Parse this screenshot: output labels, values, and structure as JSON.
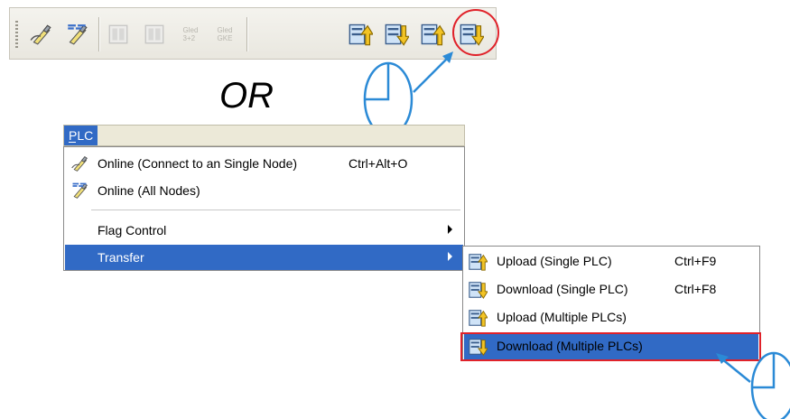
{
  "colors": {
    "selection": "#316ac5",
    "highlight": "#e0222a",
    "pointer": "#2b8ad6"
  },
  "toolbar": {
    "buttons": [
      {
        "icon": "online-single-node-icon"
      },
      {
        "icon": "online-all-nodes-icon"
      },
      {
        "icon": "disabled-icon-1"
      },
      {
        "icon": "disabled-icon-2"
      },
      {
        "icon": "disabled-icon-3",
        "ghost_text": [
          "Gled",
          "3+2"
        ]
      },
      {
        "icon": "disabled-icon-4",
        "ghost_text": [
          "Gled",
          "GKE"
        ]
      },
      {
        "icon": "upload-single-plc-icon"
      },
      {
        "icon": "download-single-plc-icon"
      },
      {
        "icon": "upload-multiple-plcs-icon"
      },
      {
        "icon": "download-multiple-plcs-icon"
      }
    ]
  },
  "or_label": "OR",
  "menu_bar": {
    "plc_label": "PLC"
  },
  "main_menu": {
    "items": [
      {
        "label": "Online (Connect to an Single Node)",
        "shortcut": "Ctrl+Alt+O",
        "icon": "online-single-node-icon"
      },
      {
        "label": "Online (All Nodes)",
        "icon": "online-all-nodes-icon"
      },
      {
        "label": "Flag Control",
        "submenu": true
      },
      {
        "label": "Transfer",
        "submenu": true,
        "selected": true
      }
    ]
  },
  "submenu": {
    "items": [
      {
        "label": "Upload (Single PLC)",
        "shortcut": "Ctrl+F9",
        "icon": "upload-single-plc-icon"
      },
      {
        "label": "Download (Single PLC)",
        "shortcut": "Ctrl+F8",
        "icon": "download-single-plc-icon"
      },
      {
        "label": "Upload (Multiple PLCs)",
        "icon": "upload-multiple-plcs-icon"
      },
      {
        "label": "Download (Multiple PLCs)",
        "icon": "download-multiple-plcs-icon",
        "selected": true
      }
    ]
  }
}
